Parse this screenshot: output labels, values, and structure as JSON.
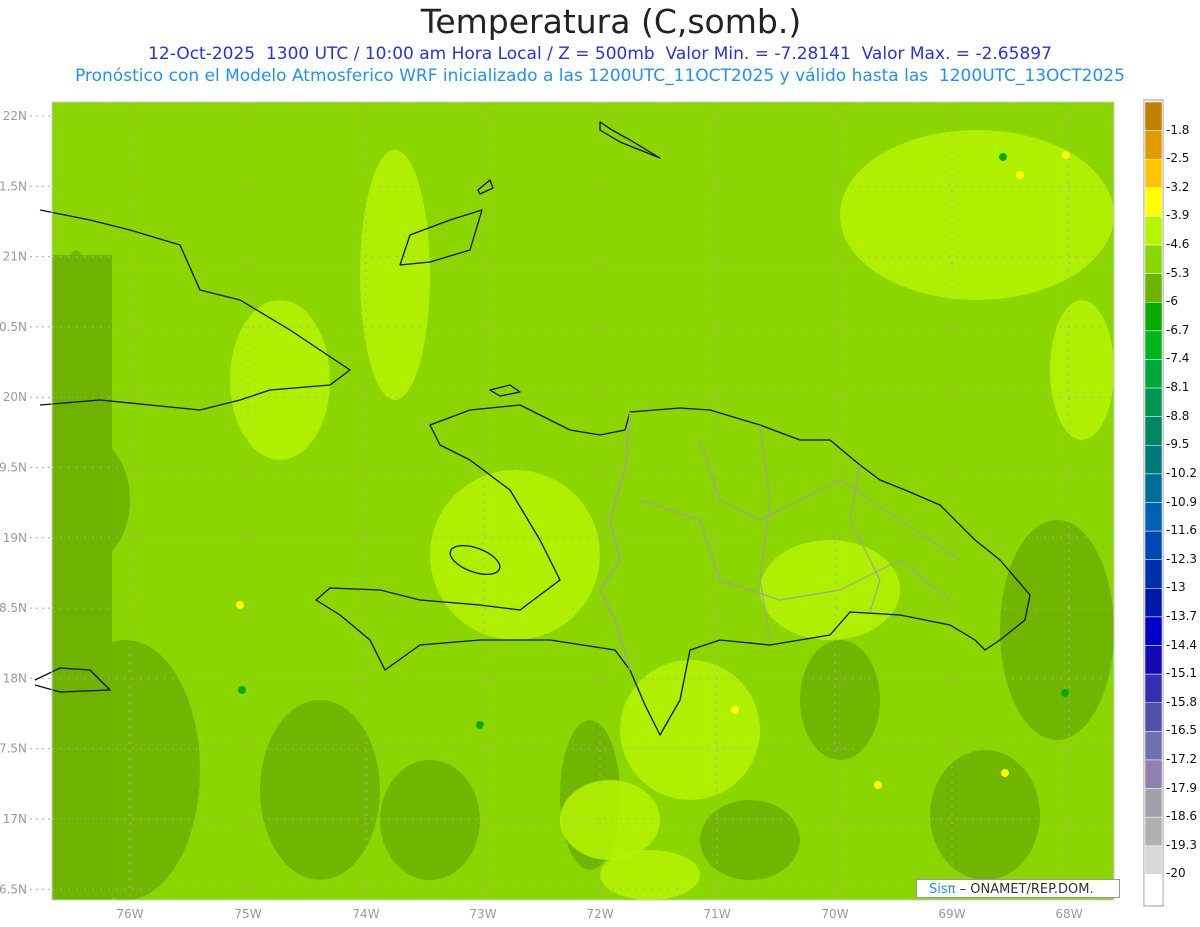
{
  "title": "Temperatura (C,somb.)",
  "subtitle1": "12-Oct-2025  1300 UTC / 10:00 am Hora Local / Z = 500mb  Valor Min. = -7.28141  Valor Max. = -2.65897",
  "subtitle2": "Pronóstico con el Modelo Atmosferico WRF inicializado a las 1200UTC_11OCT2025 y válido hasta las  1200UTC_13OCT2025",
  "lon_labels": [
    "76W",
    "75W",
    "74W",
    "73W",
    "72W",
    "71W",
    "70W",
    "69W",
    "68W"
  ],
  "lat_labels": [
    "22N",
    "1.5N",
    "21N",
    "0.5N",
    "20N",
    "9.5N",
    "19N",
    "8.5N",
    "18N",
    "7.5N",
    "17N",
    "6.5N"
  ],
  "colorbar": {
    "labels": [
      "-1.8",
      "-2.5",
      "-3.2",
      "-3.9",
      "-4.6",
      "-5.3",
      "-6",
      "-6.7",
      "-7.4",
      "-8.1",
      "-8.8",
      "-9.5",
      "-10.2",
      "-10.9",
      "-11.6",
      "-12.3",
      "-13",
      "-13.7",
      "-14.4",
      "-15.1",
      "-15.8",
      "-16.5",
      "-17.2",
      "-17.9",
      "-18.6",
      "-19.3",
      "-20"
    ],
    "colors": [
      "#c08000",
      "#e19a00",
      "#ffc400",
      "#ffff00",
      "#b4f500",
      "#8cd600",
      "#6db300",
      "#0aaa00",
      "#00b41e",
      "#00a83c",
      "#009650",
      "#008864",
      "#007a7a",
      "#006e96",
      "#0060b4",
      "#0048b4",
      "#0030b0",
      "#0018aa",
      "#0000c8",
      "#1408b4",
      "#3030b0",
      "#5050aa",
      "#7070b0",
      "#9080b0",
      "#a0a0aa",
      "#b0b0b0",
      "#d8d8d8",
      "#ffffff"
    ]
  },
  "credit": {
    "brand": "Sisπ",
    "text": "– ONAMET/REP.DOM."
  },
  "colors": {
    "base": "#8cd600",
    "dark": "#6db300",
    "light": "#b4f500",
    "coast": "#111111",
    "border": "#a0a0a0"
  }
}
